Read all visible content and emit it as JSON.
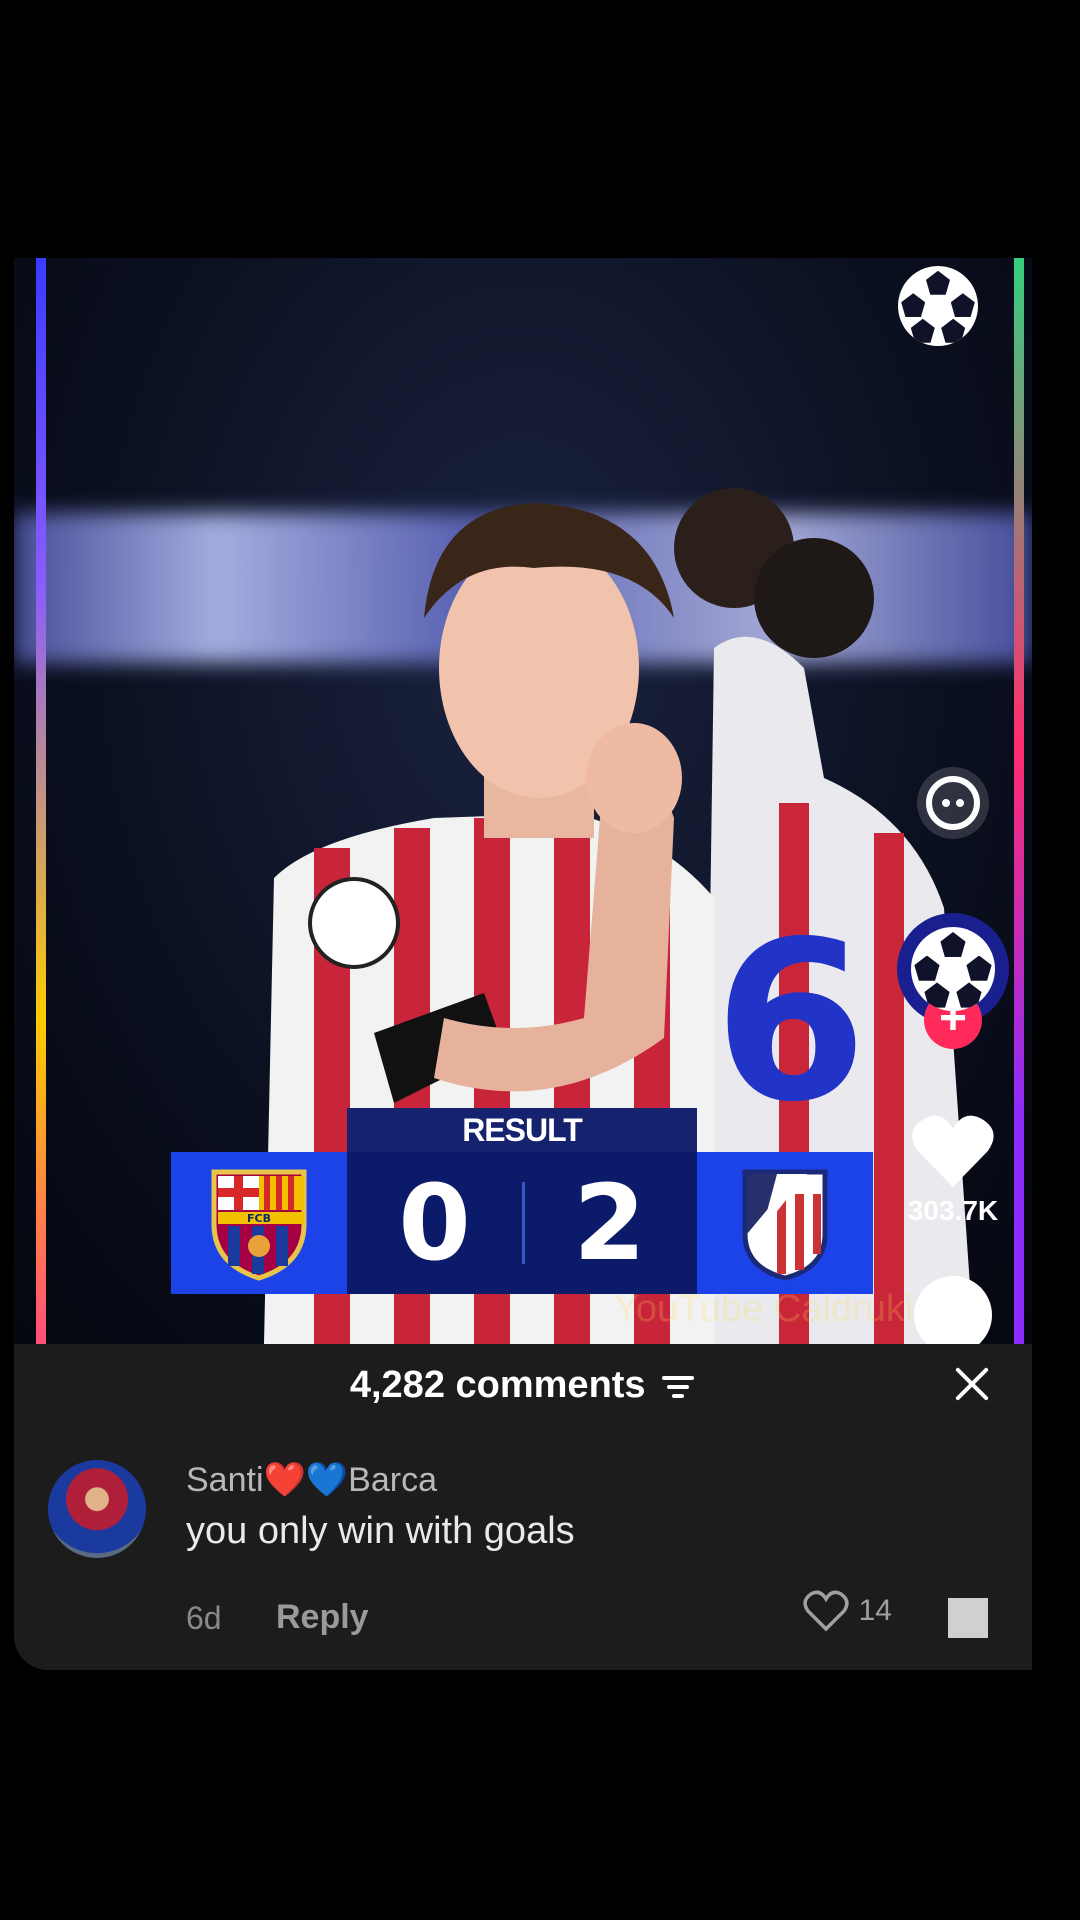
{
  "video": {
    "result_label": "RESULT",
    "home_team": "FCB",
    "home_score": "0",
    "away_score": "2",
    "watermark": "YouTube Caldruki"
  },
  "rail": {
    "likes": "303.7K",
    "follow_symbol": "+"
  },
  "comments": {
    "count_label": "4,282 comments",
    "items": [
      {
        "user": "Santi❤️💙Barca",
        "text": "you only win with goals",
        "age": "6d",
        "reply_label": "Reply",
        "likes": "14"
      }
    ]
  },
  "colors": {
    "accent": "#ff2a5a",
    "score_panel": "#0c1a6a",
    "team_box": "#1c43e8"
  },
  "icons": [
    "ucl-ball-icon",
    "comment-bubble-icon",
    "heart-icon",
    "filter-icon",
    "close-icon",
    "square-icon"
  ]
}
